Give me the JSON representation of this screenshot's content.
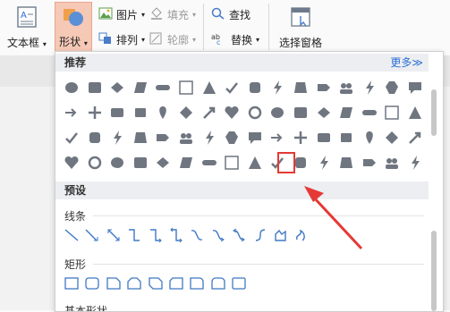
{
  "ribbon": {
    "text_box": {
      "label": "文本框",
      "icon": "text-box-icon"
    },
    "shape": {
      "label": "形状",
      "icon": "shape-icon"
    },
    "picture": {
      "label": "图片"
    },
    "fill": {
      "label": "填充"
    },
    "arrange": {
      "label": "排列"
    },
    "outline": {
      "label": "轮廓"
    },
    "find": {
      "label": "查找"
    },
    "replace": {
      "label": "替换"
    },
    "selection_pane": {
      "label": "选择窗格"
    }
  },
  "panel": {
    "recommended": {
      "title": "推荐",
      "more": "更多≫"
    },
    "presets": {
      "title": "预设"
    },
    "lines": {
      "title": "线条"
    },
    "rectangles": {
      "title": "矩形"
    },
    "basic_shapes": {
      "title": "基本形状"
    }
  },
  "colors": {
    "accent": "#2b6fd6",
    "highlight": "#e53935",
    "shape_fill": "#6f7680"
  }
}
